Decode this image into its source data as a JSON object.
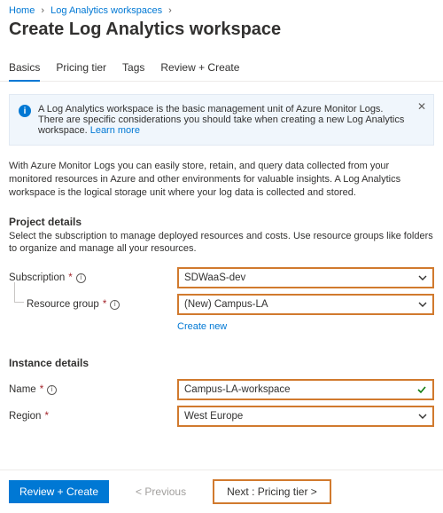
{
  "breadcrumb": {
    "home": "Home",
    "workspaces": "Log Analytics workspaces"
  },
  "page_title": "Create Log Analytics workspace",
  "tabs": {
    "basics": "Basics",
    "pricing": "Pricing tier",
    "tags": "Tags",
    "review": "Review + Create"
  },
  "banner": {
    "text": "A Log Analytics workspace is the basic management unit of Azure Monitor Logs. There are specific considerations you should take when creating a new Log Analytics workspace. ",
    "link": "Learn more"
  },
  "intro": "With Azure Monitor Logs you can easily store, retain, and query data collected from your monitored resources in Azure and other environments for valuable insights. A Log Analytics workspace is the logical storage unit where your log data is collected and stored.",
  "project": {
    "title": "Project details",
    "desc": "Select the subscription to manage deployed resources and costs. Use resource groups like folders to organize and manage all your resources.",
    "subscription_label": "Subscription",
    "subscription_value": "SDWaaS-dev",
    "rg_label": "Resource group",
    "rg_value": "(New) Campus-LA",
    "create_new": "Create new"
  },
  "instance": {
    "title": "Instance details",
    "name_label": "Name",
    "name_value": "Campus-LA-workspace",
    "region_label": "Region",
    "region_value": "West Europe"
  },
  "footer": {
    "review": "Review + Create",
    "prev": "< Previous",
    "next": "Next : Pricing tier >"
  }
}
